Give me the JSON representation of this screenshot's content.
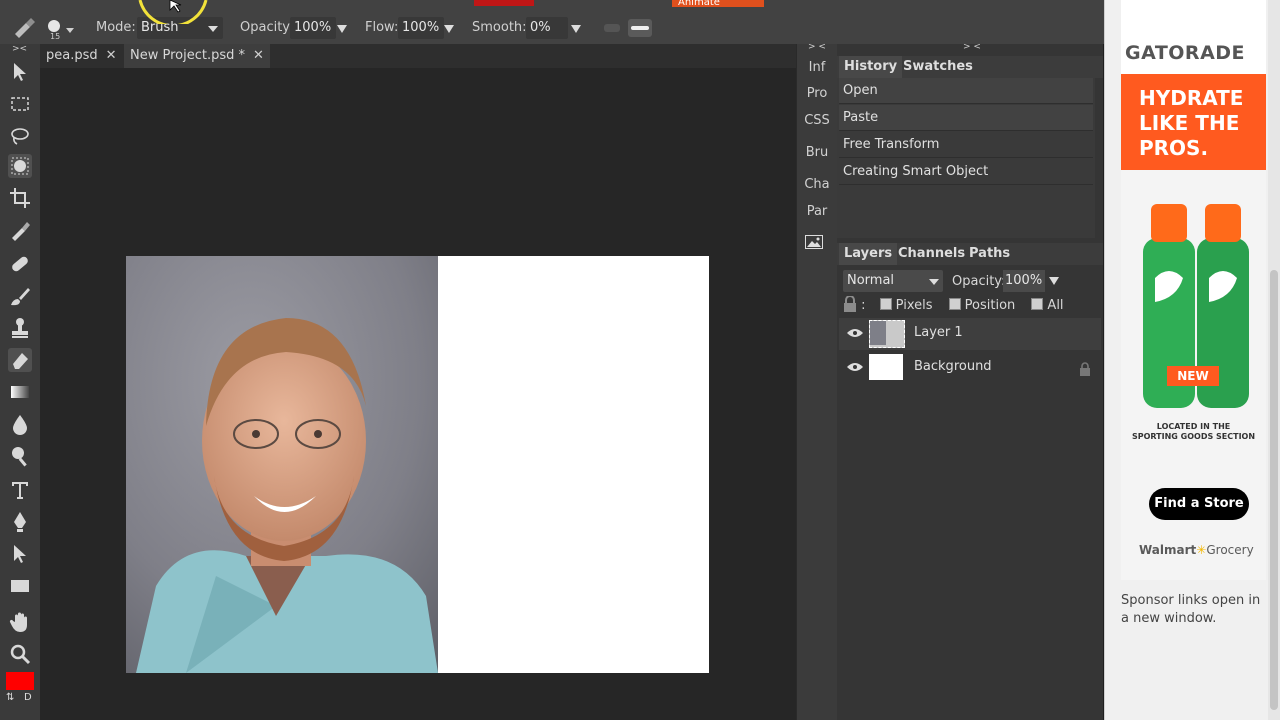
{
  "optionbar": {
    "mode_label": "Mode:",
    "mode_value": "Brush",
    "opacity_label": "Opacity:",
    "opacity_value": "100%",
    "flow_label": "Flow:",
    "flow_value": "100%",
    "smooth_label": "Smooth:",
    "smooth_value": "0%",
    "brush_size": "15",
    "top_button_label": "Animate"
  },
  "tabs": [
    {
      "label": "pea.psd"
    },
    {
      "label": "New Project.psd *"
    }
  ],
  "toolbar": {
    "foreground_color": "#ff0000",
    "tools": [
      "move-icon",
      "marquee-icon",
      "lasso-icon",
      "quick-select-icon",
      "crop-icon",
      "eyedropper-icon",
      "healing-icon",
      "brush-icon",
      "stamp-icon",
      "eraser-icon",
      "gradient-icon",
      "blur-icon",
      "dodge-icon",
      "type-icon",
      "pen-icon",
      "path-select-icon",
      "rectangle-icon",
      "hand-icon",
      "zoom-icon"
    ]
  },
  "minipanel": {
    "toggle": "> <",
    "items": [
      "Inf",
      "Pro",
      "CSS",
      "Bru",
      "Cha",
      "Par"
    ]
  },
  "history": {
    "collapse": "> <",
    "tabs": [
      "History",
      "Swatches"
    ],
    "items": [
      "Open",
      "Paste",
      "Free Transform",
      "Creating Smart Object"
    ]
  },
  "layers": {
    "tabs": [
      "Layers",
      "Channels",
      "Paths"
    ],
    "blend_mode": "Normal",
    "opacity_label": "Opacity:",
    "opacity_value": "100%",
    "lock_colon": ":",
    "lock_options": [
      "Pixels",
      "Position",
      "All"
    ],
    "items": [
      {
        "name": "Layer 1"
      },
      {
        "name": "Background"
      }
    ]
  },
  "ad": {
    "brand": "GATORADE",
    "headline_1": "HYDRATE",
    "headline_2": "LIKE THE",
    "headline_3": "PROS.",
    "badge": "NEW",
    "located_1": "LOCATED IN THE",
    "located_2": "SPORTING GOODS SECTION",
    "cta": "Find a Store",
    "retailer": "Walmart",
    "retailer_suffix": "Grocery",
    "sponsor_note": "Sponsor links open in a new window.",
    "accent_color": "#ff5a1f"
  }
}
